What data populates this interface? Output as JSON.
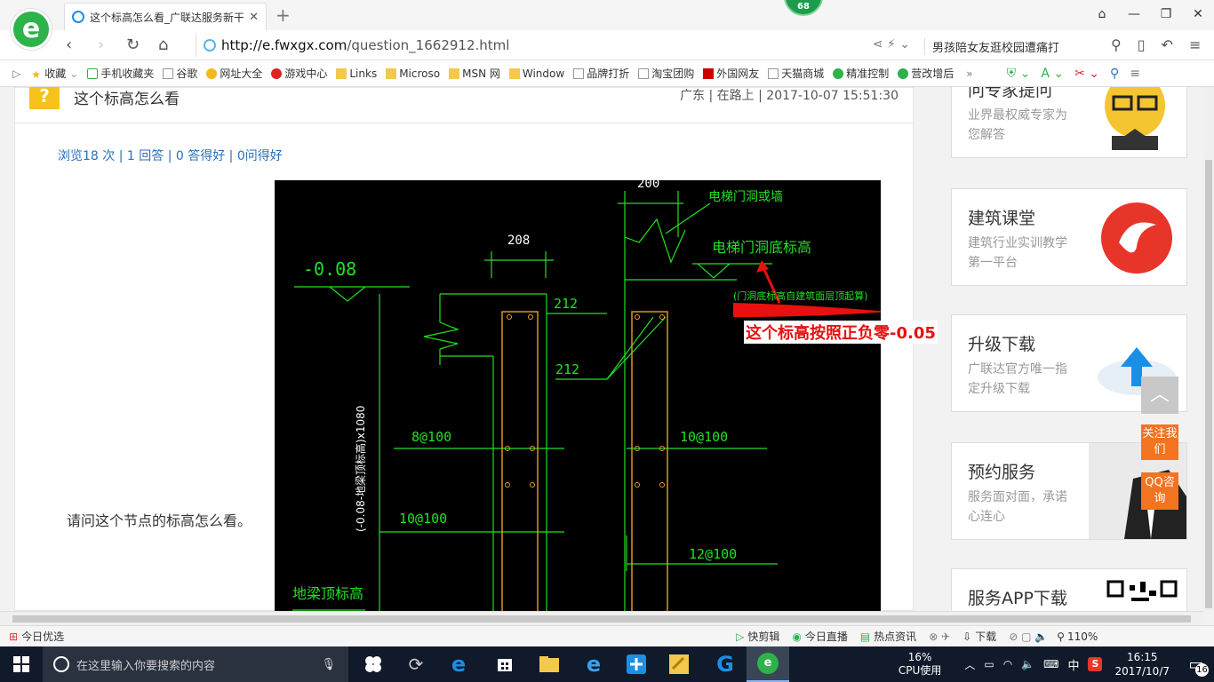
{
  "browser": {
    "tab_title": "这个标高怎么看_广联达服务新干线",
    "badge": "68",
    "url_host": "http://e.fwxgx.com",
    "url_path": "/question_1662912.html",
    "search_text": "男孩陪女友逛校园遭痛打",
    "bookmarks": [
      "收藏",
      "手机收藏夹",
      "谷歌",
      "网址大全",
      "游戏中心",
      "Links",
      "Microso",
      "MSN 网",
      "Window",
      "品牌打折",
      "淘宝团购",
      "外国网友",
      "天猫商城",
      "精准控制",
      "营改增后"
    ]
  },
  "question": {
    "title": "这个标高怎么看",
    "meta": "广东 | 在路上 | 2017-10-07 15:51:30",
    "stats": "浏览18 次 | 1 回答 | 0 答得好 | 0问得好",
    "body": "请问这个节点的标高怎么看。"
  },
  "cad": {
    "dim_200": "200",
    "dim_208": "208",
    "neg_level": "-0.08",
    "elevator_wall": "电梯门洞或墙",
    "elevator_bottom": "电梯门洞底标高",
    "note_small": "(门洞底标高自建筑面层顶起算)",
    "annotation": "这个标高按照正负零-0.05",
    "dim_212a": "212",
    "dim_212b": "212",
    "rebar_8": "8@100",
    "rebar_10a": "10@100",
    "rebar_10b": "10@100",
    "rebar_12": "12@100",
    "vertical_text": "(-0.08-地梁顶标高)x1080",
    "ground_beam": "地梁顶标高",
    "colors": {
      "green": "#22e022",
      "orange": "#e8a020",
      "red": "#e81010"
    }
  },
  "sidebar": [
    {
      "title": "问专家提问",
      "desc": "业界最权威专家为您解答"
    },
    {
      "title": "建筑课堂",
      "desc": "建筑行业实训教学第一平台"
    },
    {
      "title": "升级下载",
      "desc": "广联达官方唯一指定升级下载"
    },
    {
      "title": "预约服务",
      "desc": "服务面对面，承诺心连心"
    },
    {
      "title": "服务APP下载",
      "desc": ""
    }
  ],
  "float": {
    "follow": "关注我们",
    "qq": "QQ咨询"
  },
  "statusbar": {
    "left": "今日优选",
    "items": [
      "快剪辑",
      "今日直播",
      "热点资讯",
      "下载"
    ],
    "zoom": "110%"
  },
  "taskbar": {
    "search_placeholder": "在这里输入你要搜索的内容",
    "cpu_pct": "16%",
    "cpu_label": "CPU使用",
    "ime": "中",
    "time": "16:15",
    "date": "2017/10/7",
    "notif": "16"
  }
}
